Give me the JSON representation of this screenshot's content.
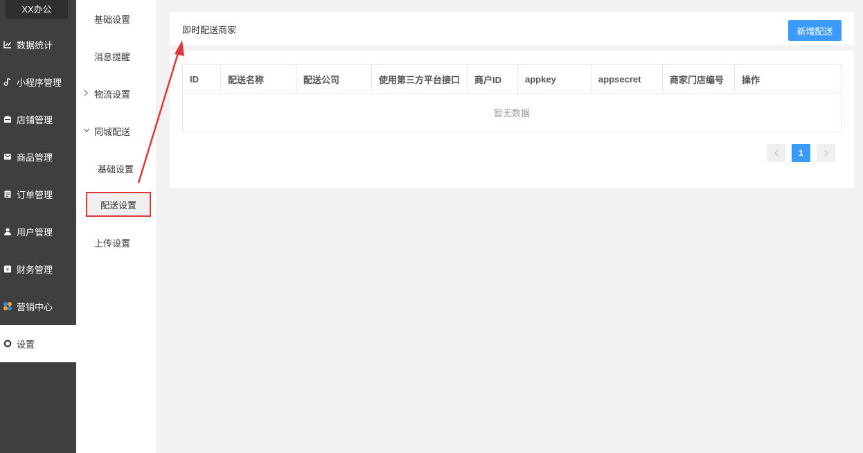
{
  "sidebar": {
    "brand": "XX办公",
    "items": [
      {
        "label": "数据统计",
        "icon": "chart-line-icon"
      },
      {
        "label": "小程序管理",
        "icon": "music-note-icon"
      },
      {
        "label": "店铺管理",
        "icon": "store-icon"
      },
      {
        "label": "商品管理",
        "icon": "mail-icon"
      },
      {
        "label": "订单管理",
        "icon": "clipboard-icon"
      },
      {
        "label": "用户管理",
        "icon": "user-icon"
      },
      {
        "label": "财务管理",
        "icon": "finance-icon"
      },
      {
        "label": "营销中心",
        "icon": "marketing-icon"
      },
      {
        "label": "设置",
        "icon": "gear-icon"
      }
    ],
    "active": "设置"
  },
  "submenu": {
    "items": [
      {
        "label": "基础设置"
      },
      {
        "label": "消息提醒"
      },
      {
        "label": "物流设置"
      },
      {
        "label": "同城配送"
      },
      {
        "label": "基础设置"
      },
      {
        "label": "配送设置"
      },
      {
        "label": "上传设置"
      }
    ]
  },
  "main": {
    "title": "即时配送商家",
    "add_button": "新增配送",
    "table": {
      "columns": [
        "ID",
        "配送名称",
        "配送公司",
        "使用第三方平台接口",
        "商户ID",
        "appkey",
        "appsecret",
        "商家门店编号",
        "操作"
      ],
      "empty_text": "暂无数据"
    },
    "pagination": {
      "prev": "‹",
      "current": "1",
      "next": "›"
    }
  },
  "colors": {
    "accent": "#3a9bfa",
    "highlight": "#e0353a",
    "sidebar_bg": "#3f3f3f"
  }
}
